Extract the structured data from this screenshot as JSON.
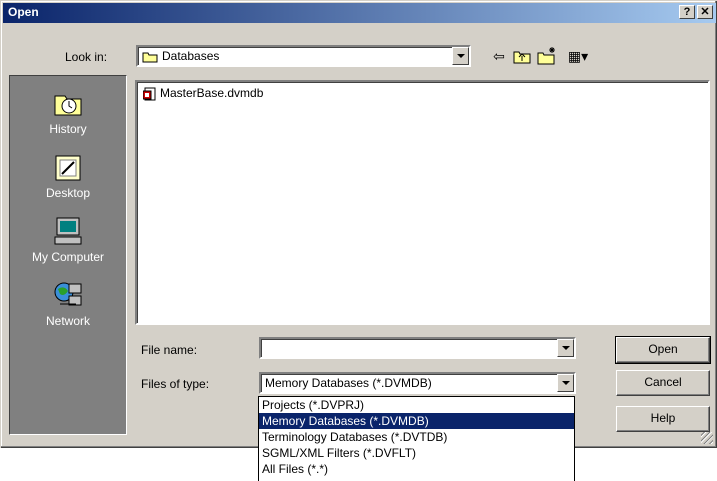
{
  "window": {
    "title": "Open",
    "help_glyph": "?",
    "close_glyph": "✕"
  },
  "look_in": {
    "label": "Look in:",
    "value": "Databases"
  },
  "toolbar": {
    "back_glyph": "⇦",
    "up_glyph": "⮤",
    "new_folder_glyph": "✱",
    "views_glyph": "▦▾"
  },
  "places": [
    {
      "label": "History",
      "icon": "history-icon"
    },
    {
      "label": "Desktop",
      "icon": "desktop-icon"
    },
    {
      "label": "My Computer",
      "icon": "my-computer-icon"
    },
    {
      "label": "Network",
      "icon": "network-icon"
    }
  ],
  "files": [
    {
      "name": "MasterBase.dvmdb",
      "icon": "database-file-icon"
    }
  ],
  "file_name": {
    "label": "File name:",
    "value": ""
  },
  "file_type": {
    "label": "Files of type:",
    "value": "Memory Databases (*.DVMDB)"
  },
  "file_type_options": [
    "Projects (*.DVPRJ)",
    "Memory Databases (*.DVMDB)",
    "Terminology Databases (*.DVTDB)",
    "SGML/XML Filters (*.DVFLT)",
    "All Files (*.*)"
  ],
  "file_type_selected_index": 1,
  "buttons": {
    "open": "Open",
    "cancel": "Cancel",
    "help": "Help"
  },
  "colors": {
    "titlebar": "#0a246a",
    "face": "#d4d0c8",
    "selection": "#0a246a",
    "places_bg": "#808080"
  }
}
